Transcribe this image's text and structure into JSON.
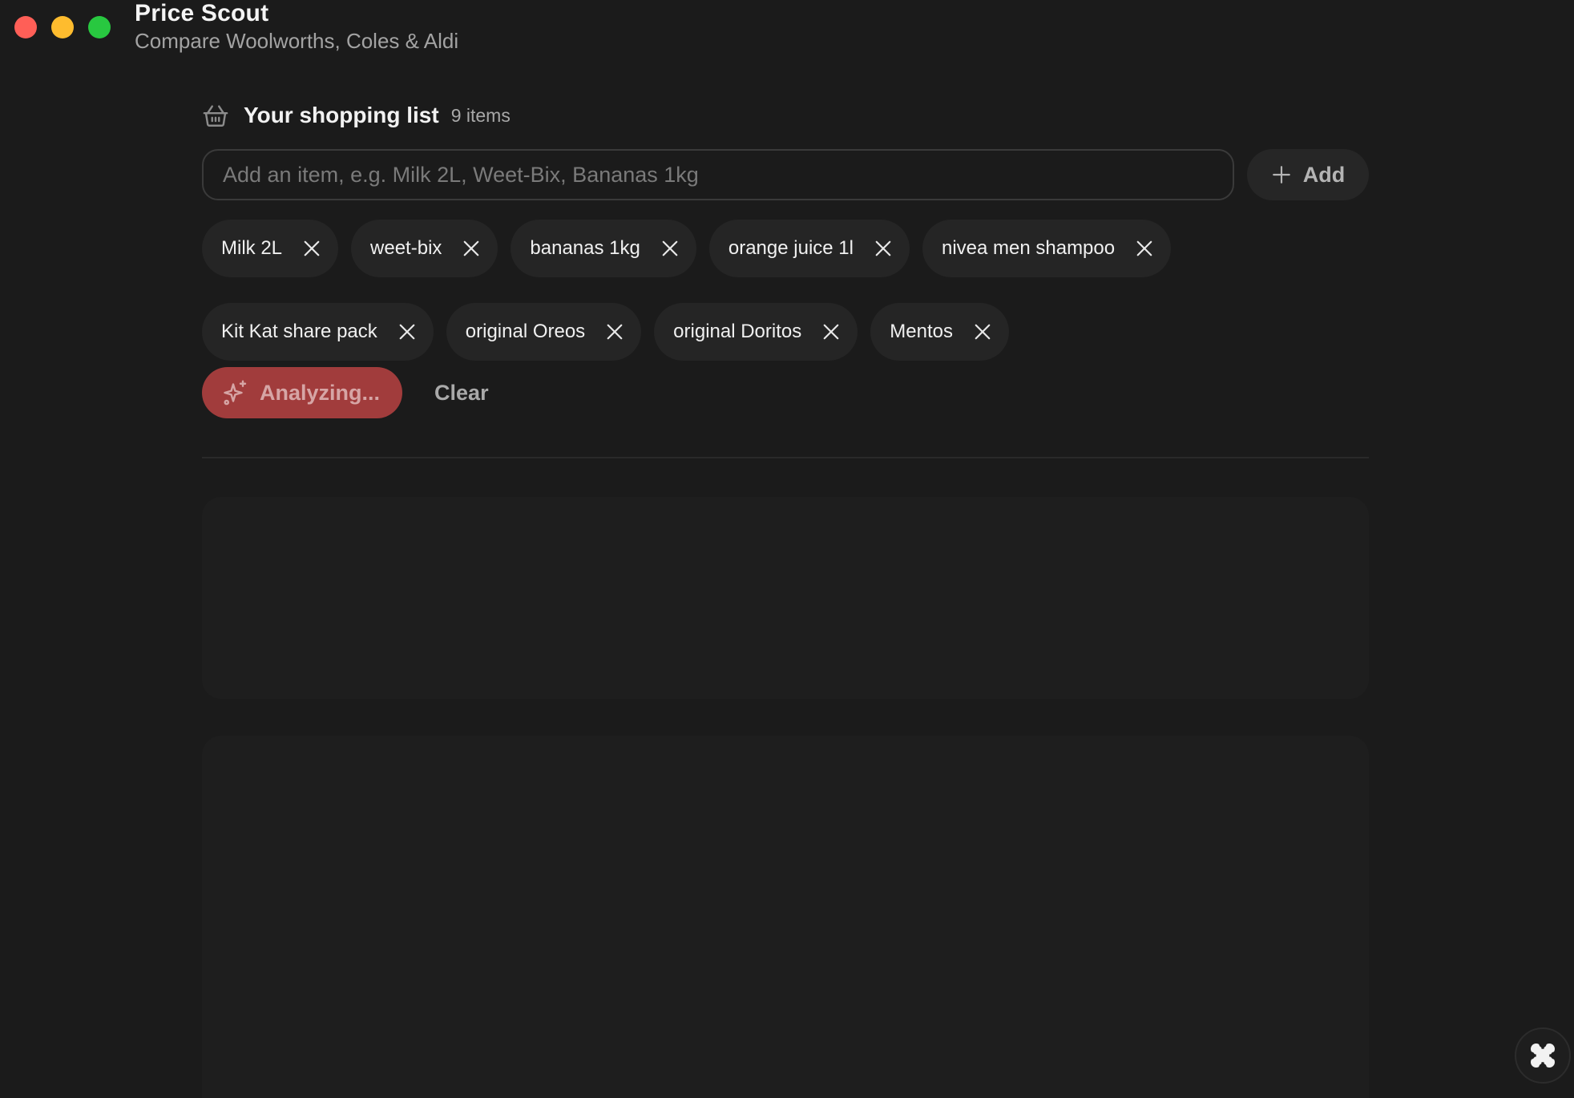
{
  "app": {
    "title": "Price Scout",
    "subtitle": "Compare Woolworths, Coles & Aldi"
  },
  "shopping_list": {
    "title": "Your shopping list",
    "count": "9 items",
    "icon": "basket-icon"
  },
  "input": {
    "placeholder": "Add an item, e.g. Milk 2L, Weet-Bix, Bananas 1kg",
    "value": ""
  },
  "add_button": {
    "label": "Add",
    "icon": "plus-icon"
  },
  "items": [
    "Milk 2L",
    "weet-bix",
    "bananas 1kg",
    "orange juice 1l",
    "nivea men shampoo",
    "Kit Kat share pack",
    "original Oreos",
    "original Doritos",
    "Mentos"
  ],
  "actions": {
    "analyze_label": "Analyzing...",
    "analyze_icon": "sparkles-icon",
    "clear_label": "Clear"
  },
  "colors": {
    "background": "#1b1b1b",
    "chip_bg": "#252525",
    "accent": "#a13c3c",
    "traffic_close": "#ff5f57",
    "traffic_min": "#febc2e",
    "traffic_max": "#28c840"
  }
}
